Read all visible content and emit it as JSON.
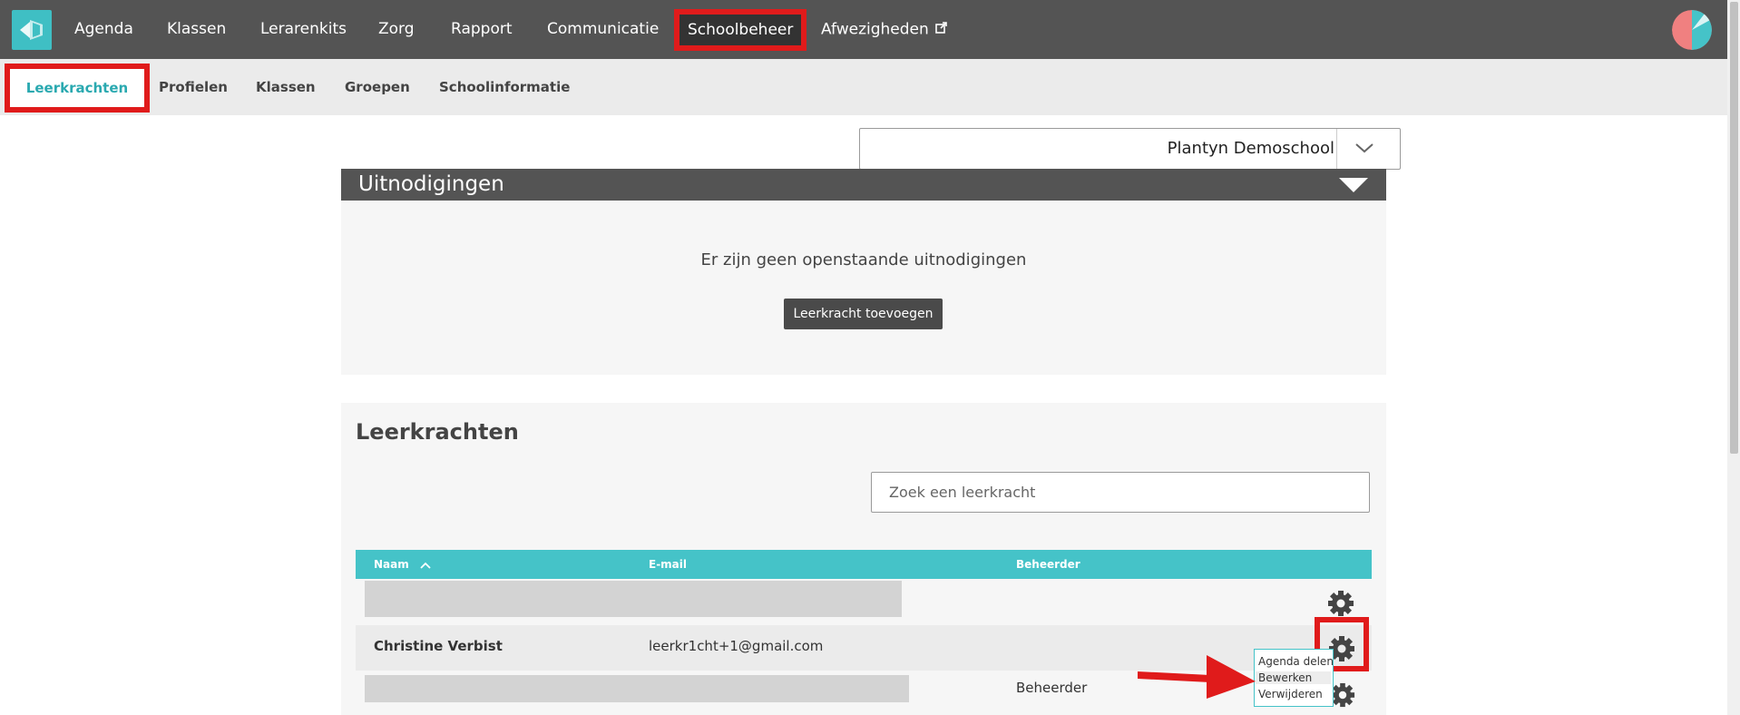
{
  "nav": {
    "items": [
      "Agenda",
      "Klassen",
      "Lerarenkits",
      "Zorg",
      "Rapport",
      "Communicatie",
      "Schoolbeheer",
      "Afwezigheden"
    ],
    "active": "Schoolbeheer"
  },
  "subnav": {
    "items": [
      "Leerkrachten",
      "Profielen",
      "Klassen",
      "Groepen",
      "Schoolinformatie"
    ],
    "active": "Leerkrachten"
  },
  "school_select": {
    "value": "Plantyn Demoschool"
  },
  "invitations": {
    "title": "Uitnodigingen",
    "empty_text": "Er zijn geen openstaande uitnodigingen",
    "add_button": "Leerkracht toevoegen"
  },
  "teachers": {
    "title": "Leerkrachten",
    "search_placeholder": "Zoek een leerkracht",
    "columns": {
      "name": "Naam",
      "email": "E-mail",
      "admin": "Beheerder"
    },
    "rows": [
      {
        "name": "",
        "email": "",
        "admin": ""
      },
      {
        "name": "Christine Verbist",
        "email": "leerkr1cht+1@gmail.com",
        "admin": ""
      },
      {
        "name": "",
        "email": "",
        "admin": "Beheerder"
      }
    ]
  },
  "context_menu": {
    "items": [
      "Agenda delen",
      "Bewerken",
      "Verwijderen"
    ]
  },
  "colors": {
    "topbar": "#545454",
    "accent": "#45c3c8",
    "highlight": "#e01b1b"
  },
  "icons": [
    "app-logo-icon",
    "external-link-icon",
    "user-avatar-icon",
    "chevron-down-icon",
    "triangle-toggle-icon",
    "sort-asc-icon",
    "gear-icon"
  ]
}
